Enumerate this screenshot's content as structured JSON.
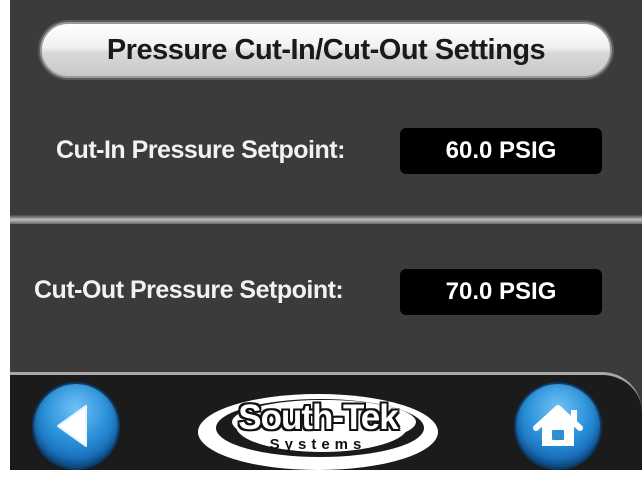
{
  "title_button": {
    "label": "Pressure Cut-In/Cut-Out Settings"
  },
  "settings": {
    "cut_in": {
      "label": "Cut-In Pressure Setpoint:",
      "value": "60.0 PSIG"
    },
    "cut_out": {
      "label": "Cut-Out Pressure Setpoint:",
      "value": "70.0 PSIG"
    }
  },
  "nav": {
    "back_icon": "left-arrow-icon",
    "home_icon": "home-icon"
  },
  "logo": {
    "brand": "South-Tek",
    "sub": "Systems"
  },
  "colors": {
    "background": "#3b3b3b",
    "navbar": "#1b1b1b",
    "value_box": "#000000",
    "nav_button_blue": "#2a8fd8"
  }
}
